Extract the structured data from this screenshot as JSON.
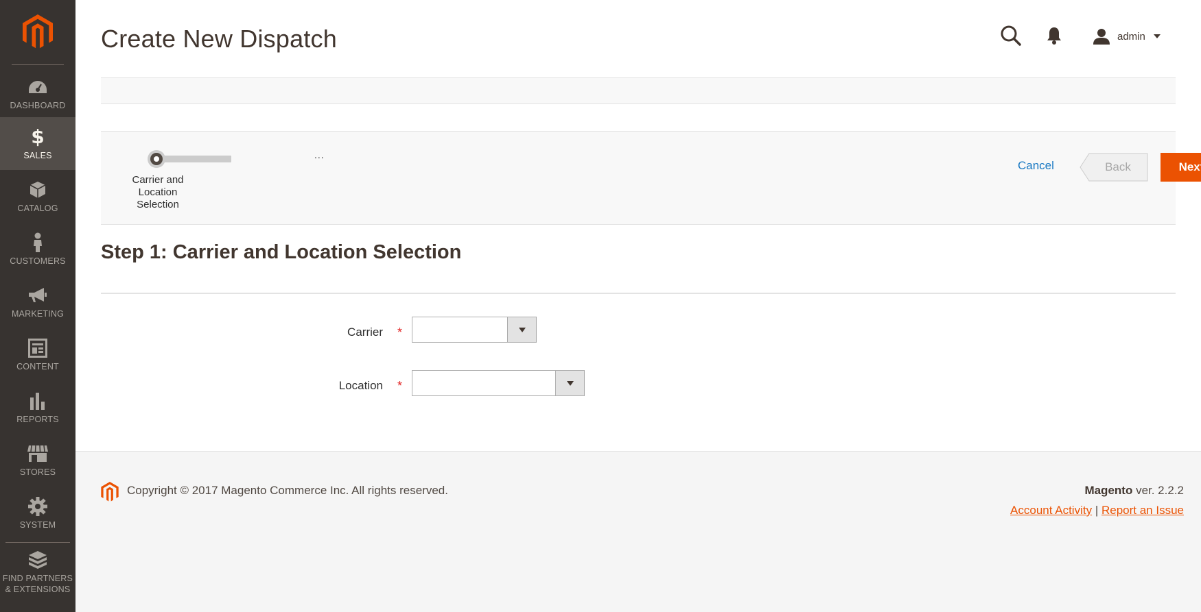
{
  "sidebar": {
    "items": [
      {
        "label": "DASHBOARD",
        "icon": "dashboard-icon"
      },
      {
        "label": "SALES",
        "icon": "dollar-icon",
        "active": true
      },
      {
        "label": "CATALOG",
        "icon": "box-icon"
      },
      {
        "label": "CUSTOMERS",
        "icon": "person-icon"
      },
      {
        "label": "MARKETING",
        "icon": "megaphone-icon"
      },
      {
        "label": "CONTENT",
        "icon": "layout-icon"
      },
      {
        "label": "REPORTS",
        "icon": "bar-chart-icon"
      },
      {
        "label": "STORES",
        "icon": "storefront-icon"
      },
      {
        "label": "SYSTEM",
        "icon": "gear-icon"
      }
    ],
    "partners": {
      "line1": "FIND PARTNERS",
      "line2": "& EXTENSIONS",
      "icon": "blocks-icon"
    }
  },
  "header": {
    "title": "Create New Dispatch",
    "user": "admin"
  },
  "wizard": {
    "step_label": "Carrier and Location Selection",
    "more": "...",
    "cancel": "Cancel",
    "back": "Back",
    "next": "Next"
  },
  "step": {
    "title": "Step 1: Carrier and Location Selection",
    "fields": {
      "carrier": {
        "label": "Carrier",
        "required": "*",
        "value": ""
      },
      "location": {
        "label": "Location",
        "required": "*",
        "value": ""
      }
    }
  },
  "footer": {
    "copyright": "Copyright © 2017 Magento Commerce Inc. All rights reserved.",
    "brand": "Magento",
    "version": "ver. 2.2.2",
    "account_activity": "Account Activity",
    "separator": "|",
    "report_issue": "Report an Issue"
  },
  "colors": {
    "sidebar_bg": "#373330",
    "accent_orange": "#eb5202",
    "link_blue": "#1979c3"
  }
}
